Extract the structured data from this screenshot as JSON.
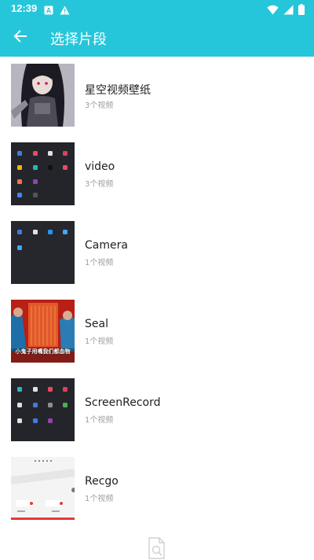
{
  "status_bar": {
    "time": "12:39",
    "left_icons": [
      "a-box-icon",
      "warning-icon"
    ],
    "right_icons": [
      "wifi-icon",
      "signal-icon",
      "battery-icon"
    ]
  },
  "app_bar": {
    "title": "选择片段",
    "back_icon": "arrow-left-icon",
    "color": "#26c6da"
  },
  "albums": [
    {
      "name": "星空视频壁纸",
      "count": "3个视频"
    },
    {
      "name": "video",
      "count": "3个视频"
    },
    {
      "name": "Camera",
      "count": "1个视频"
    },
    {
      "name": "Seal",
      "count": "1个视频",
      "thumb_caption": "小鬼子用嘴我们都血物"
    },
    {
      "name": "ScreenRecord",
      "count": "1个视频"
    },
    {
      "name": "Recgo",
      "count": "1个视频"
    }
  ],
  "bottom": {
    "icon": "document-search-icon"
  }
}
